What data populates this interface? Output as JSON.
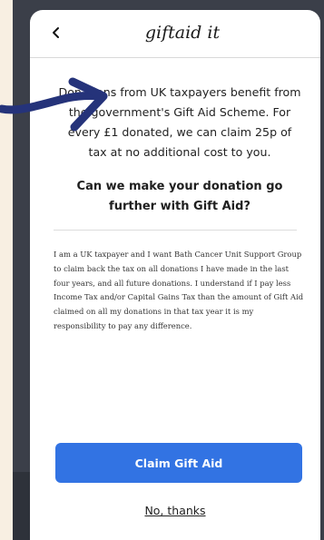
{
  "header": {
    "back_icon": "chevron-left-icon",
    "logo_text": "giftaid it"
  },
  "intro_text": "Donations from UK taxpayers benefit from the government's Gift Aid Scheme. For every £1 donated, we can claim 25p of tax at no additional cost to you.",
  "question": "Can we make your donation go further with Gift Aid?",
  "declaration": "I am a UK taxpayer and I want Bath Cancer Unit Support Group to claim back the tax on all donations I have made in the last four years, and all future donations. I understand if I pay less Income Tax and/or Capital Gains Tax than the amount of Gift Aid claimed on all my donations in that tax year it is my responsibility to pay any difference.",
  "actions": {
    "claim_label": "Claim Gift Aid",
    "decline_label": "No, thanks"
  },
  "colors": {
    "primary_button": "#3273e3",
    "annotation_arrow": "#25337a",
    "page_background": "#f8efe2",
    "overlay_backdrop": "#3b3f49"
  },
  "overlay_arrow_icon": "hand-drawn-arrow-icon"
}
